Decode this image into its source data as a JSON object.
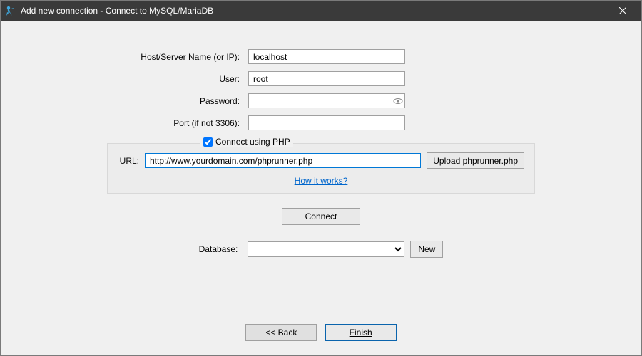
{
  "window": {
    "title": "Add new connection - Connect to MySQL/MariaDB"
  },
  "form": {
    "host_label": "Host/Server Name  (or IP):",
    "host_value": "localhost",
    "user_label": "User:",
    "user_value": "root",
    "password_label": "Password:",
    "password_value": "",
    "port_label": "Port (if not 3306):",
    "port_value": ""
  },
  "php": {
    "checkbox_label": "Connect using PHP",
    "checked": true,
    "url_label": "URL:",
    "url_value": "http://www.yourdomain.com/phprunner.php",
    "upload_label": "Upload phprunner.php",
    "how_link": "How it works?"
  },
  "connect_label": "Connect",
  "database": {
    "label": "Database:",
    "selected": "",
    "new_label": "New"
  },
  "buttons": {
    "back": "<< Back",
    "finish": "Finish"
  }
}
